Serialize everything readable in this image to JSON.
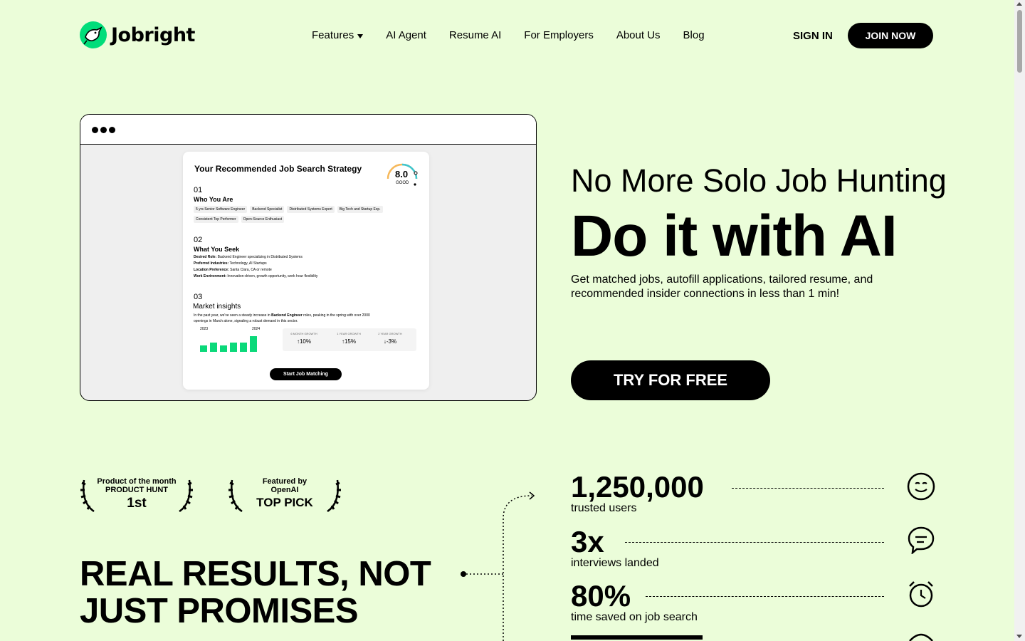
{
  "header": {
    "logo_text": "Jobright",
    "nav": [
      {
        "label": "Features",
        "has_dropdown": true
      },
      {
        "label": "AI Agent"
      },
      {
        "label": "Resume AI"
      },
      {
        "label": "For Employers"
      },
      {
        "label": "About Us"
      },
      {
        "label": "Blog"
      }
    ],
    "sign_in": "SIGN IN",
    "join_now": "JOIN NOW"
  },
  "mockup": {
    "card_title": "Your Recommended Job Search Strategy",
    "score": {
      "value": "8.0",
      "label": "GOOD"
    },
    "sections": [
      {
        "num": "01",
        "title": "Who You Are",
        "tags": [
          "5 yrs Senior Software Engineer",
          "Backend Specialist",
          "Distributed Systems Expert",
          "Big Tech and Startup Exp.",
          "Consistent Top Performer",
          "Open-Source Enthusiast"
        ]
      },
      {
        "num": "02",
        "title": "What You Seek",
        "lines": [
          {
            "k": "Desired Role:",
            "v": "Backend Engineer specializing in Distributed Systems"
          },
          {
            "k": "Preferred Industries:",
            "v": "Technology, AI Startups"
          },
          {
            "k": "Location Preference:",
            "v": "Santa Clara, CA or remote"
          },
          {
            "k": "Work Environment:",
            "v": "Innovation-driven, growth opportunity, work hour flexibility"
          }
        ]
      },
      {
        "num": "03",
        "title": "Market insights",
        "text_a": "In the past year, we've seen a steady increase in ",
        "text_b": "Backend Engineer",
        "text_c": " roles, peaking in the spring with over 2000",
        "text_d": "openings in March alone, signaling a robust demand in this sector."
      }
    ],
    "mini_chart": {
      "start_year": "2023",
      "end_year": "2024",
      "values": [
        2,
        3,
        2,
        3,
        3,
        5
      ]
    },
    "growth": [
      {
        "label": "6 MONTH GROWTH",
        "value": "↑10%"
      },
      {
        "label": "1 YEAR GROWTH",
        "value": "↑15%"
      },
      {
        "label": "2 YEAR GROWTH",
        "value": "↓-3%"
      }
    ],
    "start_button": "Start Job Matching"
  },
  "hero": {
    "subtitle": "No More Solo Job Hunting",
    "title": "Do it with AI",
    "description": "Get matched jobs, autofill applications, tailored resume, and recommended insider connections in less than 1 min!",
    "cta": "TRY FOR FREE"
  },
  "awards": [
    {
      "line1": "Product of the month",
      "line2": "PRODUCT HUNT",
      "big": "1st"
    },
    {
      "line1": "Featured by",
      "line2": "OpenAI",
      "big": "TOP PICK"
    }
  ],
  "results_heading": {
    "line1": "REAL RESULTS, NOT",
    "line2": "JUST PROMISES"
  },
  "stats": [
    {
      "value": "1,250,000",
      "label": "trusted users",
      "icon": "smile-icon"
    },
    {
      "value": "3x",
      "label": "interviews landed",
      "icon": "chat-icon"
    },
    {
      "value": "80%",
      "label": "time saved on job search",
      "icon": "alarm-clock-icon"
    }
  ]
}
